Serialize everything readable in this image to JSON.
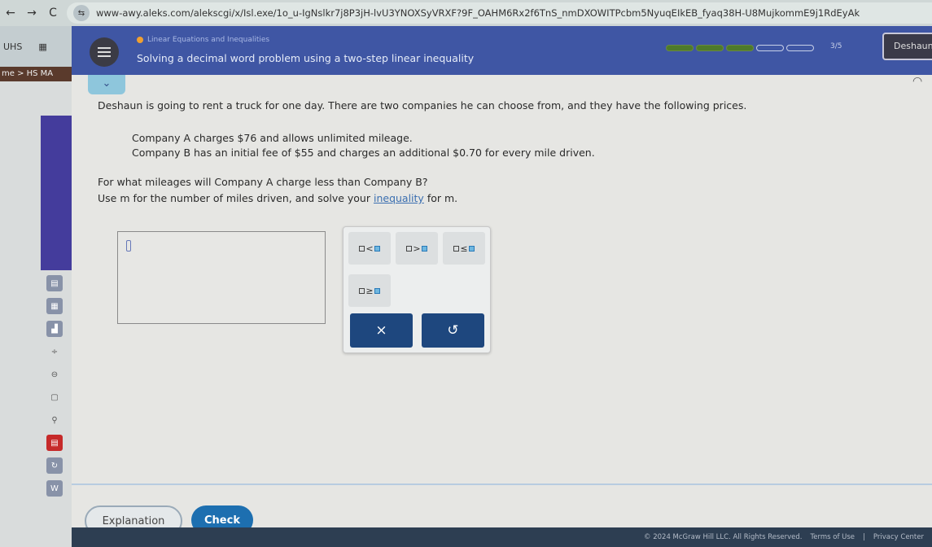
{
  "browser": {
    "back_icon": "←",
    "forward_icon": "→",
    "reload_icon": "C",
    "url": "www-awy.aleks.com/alekscgi/x/Isl.exe/1o_u-IgNslkr7j8P3jH-lvU3YNOXSyVRXF?9F_OAHM6Rx2f6TnS_nmDXOWITPcbm5NyuqEIkEB_fyaq38H-U8MujkommE9j1RdEyAk",
    "bookmarks": [
      "UHS",
      "apps"
    ],
    "breadcrumb": "me > HS MA"
  },
  "header": {
    "topic": "Linear Equations and Inequalities",
    "title": "Solving a decimal word problem using a two-step linear inequality",
    "progress": {
      "completed": 3,
      "total": 5,
      "label": "3/5"
    },
    "user_button": "Deshaune"
  },
  "question": {
    "intro": "Deshaun is going to rent a truck for one day. There are two companies he can choose from, and they have the following prices.",
    "company_a": "Company A charges $76 and allows unlimited mileage.",
    "company_b": "Company B has an initial fee of $55 and charges an additional $0.70 for every mile driven.",
    "prompt": "For what mileages will Company A charge less than Company B?",
    "instruction_pre": "Use m for the number of miles driven, and solve your ",
    "instruction_link": "inequality",
    "instruction_post": " for m."
  },
  "answer": {
    "value": ""
  },
  "keypad": {
    "keys": [
      {
        "symbol": "<",
        "name": "less-than"
      },
      {
        "symbol": ">",
        "name": "greater-than"
      },
      {
        "symbol": "≤",
        "name": "less-equal"
      },
      {
        "symbol": "≥",
        "name": "greater-equal"
      }
    ],
    "clear_label": "×",
    "undo_label": "↺"
  },
  "actions": {
    "explanation": "Explanation",
    "check": "Check"
  },
  "footer": {
    "copyright": "© 2024 McGraw Hill LLC. All Rights Reserved.",
    "terms": "Terms of Use",
    "privacy": "Privacy Center"
  },
  "colors": {
    "header": "#3f56a4",
    "check": "#1d6fb0",
    "keypad_action": "#1e477e",
    "progress_done": "#4e7a2a"
  }
}
